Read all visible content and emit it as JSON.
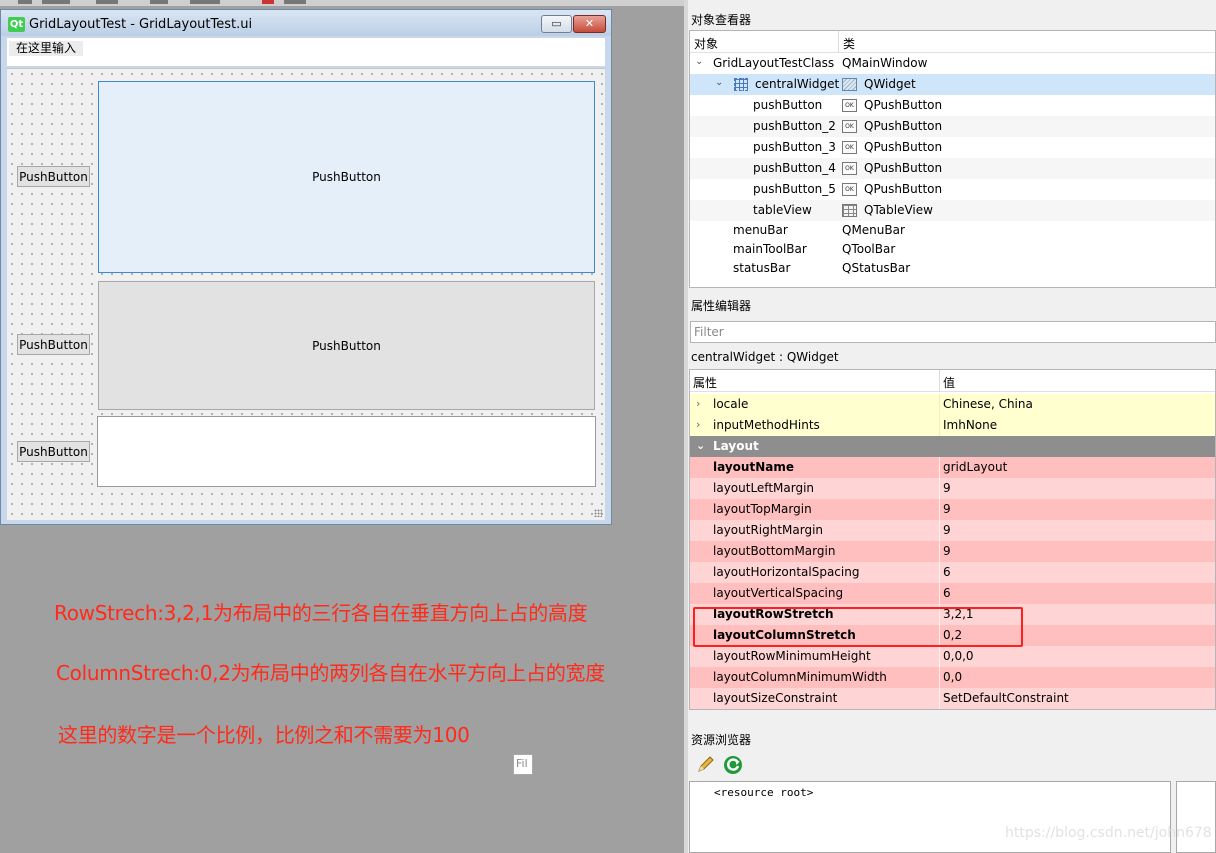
{
  "preview_window": {
    "logo_text": "Qt",
    "title": "GridLayoutTest - GridLayoutTest.ui",
    "minimize_symbol": "▭",
    "close_symbol": "✕",
    "menu_placeholder": "在这里输入",
    "buttons": {
      "small_label": "PushButton",
      "big_label": "PushButton"
    }
  },
  "annotations": [
    "RowStrech:3,2,1为布局中的三行各自在垂直方向上占的高度",
    "ColumnStrech:0,2为布局中的两列各自在水平方向上占的宽度",
    "这里的数字是一个比例，比例之和不需要为100"
  ],
  "object_inspector": {
    "title": "对象查看器",
    "col_object": "对象",
    "col_class": "类",
    "rows": [
      {
        "name": "GridLayoutTestClass",
        "cls": "QMainWindow"
      },
      {
        "name": "centralWidget",
        "cls": "QWidget"
      },
      {
        "name": "pushButton",
        "cls": "QPushButton"
      },
      {
        "name": "pushButton_2",
        "cls": "QPushButton"
      },
      {
        "name": "pushButton_3",
        "cls": "QPushButton"
      },
      {
        "name": "pushButton_4",
        "cls": "QPushButton"
      },
      {
        "name": "pushButton_5",
        "cls": "QPushButton"
      },
      {
        "name": "tableView",
        "cls": "QTableView"
      },
      {
        "name": "menuBar",
        "cls": "QMenuBar"
      },
      {
        "name": "mainToolBar",
        "cls": "QToolBar"
      },
      {
        "name": "statusBar",
        "cls": "QStatusBar"
      }
    ],
    "icon_ok": "OK"
  },
  "property_editor": {
    "title": "属性编辑器",
    "filter_placeholder": "Filter",
    "context": "centralWidget : QWidget",
    "col_property": "属性",
    "col_value": "值",
    "rows": [
      {
        "name": "locale",
        "value": "Chinese, China"
      },
      {
        "name": "inputMethodHints",
        "value": "ImhNone"
      },
      {
        "name": "Layout",
        "value": ""
      },
      {
        "name": "layoutName",
        "value": "gridLayout"
      },
      {
        "name": "layoutLeftMargin",
        "value": "9"
      },
      {
        "name": "layoutTopMargin",
        "value": "9"
      },
      {
        "name": "layoutRightMargin",
        "value": "9"
      },
      {
        "name": "layoutBottomMargin",
        "value": "9"
      },
      {
        "name": "layoutHorizontalSpacing",
        "value": "6"
      },
      {
        "name": "layoutVerticalSpacing",
        "value": "6"
      },
      {
        "name": "layoutRowStretch",
        "value": "3,2,1"
      },
      {
        "name": "layoutColumnStretch",
        "value": "0,2"
      },
      {
        "name": "layoutRowMinimumHeight",
        "value": "0,0,0"
      },
      {
        "name": "layoutColumnMinimumWidth",
        "value": "0,0"
      },
      {
        "name": "layoutSizeConstraint",
        "value": "SetDefaultConstraint"
      }
    ],
    "highlight_color": "#ff1f1f"
  },
  "resource_browser": {
    "title": "资源浏览器",
    "filter_placeholder": "Fil",
    "root_label": "<resource root>"
  },
  "watermark": "https://blog.csdn.net/john678"
}
